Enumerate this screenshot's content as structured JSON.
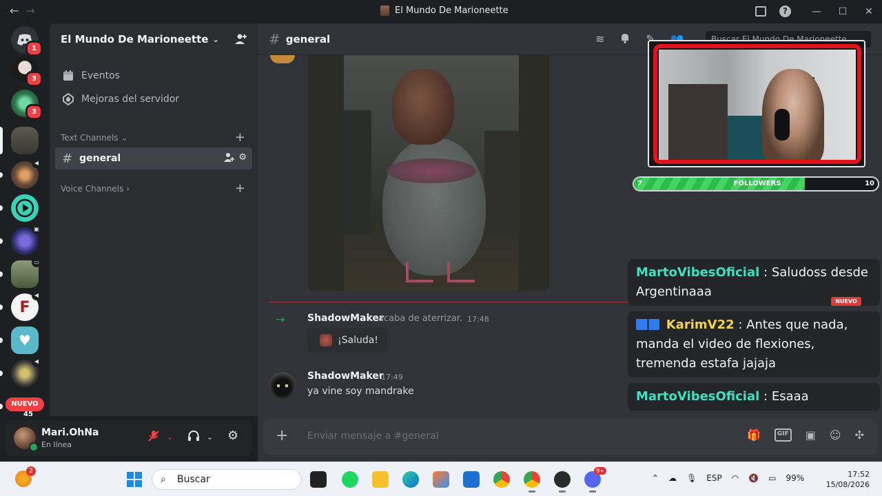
{
  "window": {
    "title": "El Mundo De Marioneette",
    "nav_back": "←",
    "nav_forward": "→",
    "btn_minimize": "—",
    "btn_maximize": "☐",
    "btn_close": "✕",
    "help": "?"
  },
  "rail": {
    "servers": [
      {
        "name": "direct-messages",
        "badge": "1",
        "color": "#5865f2"
      },
      {
        "name": "server-anime",
        "badge": "3",
        "color": "#3a3433"
      },
      {
        "name": "server-green",
        "badge": "3",
        "color": "#2f7a4a"
      },
      {
        "name": "server-ruins",
        "badge": "",
        "color": "#4a4a40"
      },
      {
        "name": "server-speaker",
        "badge": "",
        "color": "#6a5a3a"
      },
      {
        "name": "server-play",
        "badge": "",
        "color": "#3ad1b5"
      },
      {
        "name": "server-among",
        "badge": "",
        "color": "#2b2d6a"
      },
      {
        "name": "server-minecraft",
        "badge": "",
        "color": "#6a7a5a"
      },
      {
        "name": "server-f",
        "badge": "",
        "color": "#f0f0f0"
      },
      {
        "name": "server-heart",
        "badge": "",
        "color": "#5ab9c9"
      },
      {
        "name": "server-cars",
        "badge": "",
        "color": "#3a3a3a"
      }
    ],
    "nuevo_label": "NUEVO",
    "nuevo_count": "45"
  },
  "sidebar": {
    "server_name": "El Mundo De Marioneette",
    "events_label": "Eventos",
    "boost_label": "Mejoras del servidor",
    "text_category": "Text Channels",
    "voice_category": "Voice Channels",
    "active_channel": "general"
  },
  "user": {
    "name": "Mari.OhNa",
    "status": "En línea"
  },
  "channel": {
    "name": "general",
    "search_placeholder": "Buscar El Mundo De Marioneette"
  },
  "messages": {
    "join": {
      "author": "ShadowMaker",
      "text": "acaba de aterrizar.",
      "time": "17:48",
      "wave_label": "¡Saluda!"
    },
    "msg": {
      "author": "ShadowMaker",
      "time": "17:49",
      "text": "ya vine soy mandrake"
    }
  },
  "composer": {
    "placeholder": "Enviar mensaje a #general",
    "gif_label": "GIF"
  },
  "overlay": {
    "followers_label": "FOLLOWERS",
    "followers_current": "7",
    "followers_goal": "10",
    "followers_fraction": 0.7,
    "chat": [
      {
        "user": "MartoVibesOficial",
        "text": "Saludoss desde Argentinaaa"
      },
      {
        "user": "KarimV22",
        "text": "Antes que nada, manda el video de flexiones, tremenda estafa jajaja"
      },
      {
        "user": "MartoVibesOficial",
        "text": "Esaaa"
      }
    ],
    "nuevo_tag": "NUEVO"
  },
  "taskbar": {
    "weather_badge": "2",
    "search_label": "Buscar",
    "lang": "ESP",
    "battery": "99%",
    "time": "17:52",
    "date": "15/08/2026",
    "discord_badge": "9+"
  }
}
